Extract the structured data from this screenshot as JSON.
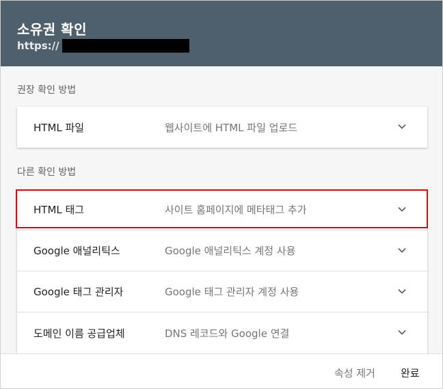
{
  "header": {
    "title": "소유권 확인",
    "url_prefix": "https://"
  },
  "recommended": {
    "label": "권장 확인 방법",
    "items": [
      {
        "name": "HTML 파일",
        "description": "웹사이트에 HTML 파일 업로드",
        "icon": "chevron-down-icon"
      }
    ]
  },
  "other": {
    "label": "다른 확인 방법",
    "items": [
      {
        "name": "HTML 태그",
        "description": "사이트 홈페이지에 메타태그 추가",
        "icon": "chevron-down-icon"
      },
      {
        "name": "Google 애널리틱스",
        "description": "Google 애널리틱스 계정 사용",
        "icon": "chevron-down-icon"
      },
      {
        "name": "Google 태그 관리자",
        "description": "Google 태그 관리자 계정 사용",
        "icon": "chevron-down-icon"
      },
      {
        "name": "도메인 이름 공급업체",
        "description": "DNS 레코드와 Google 연결",
        "icon": "chevron-down-icon"
      }
    ]
  },
  "footer": {
    "remove_label": "속성 제거",
    "done_label": "완료"
  },
  "colors": {
    "header_bg": "#4f606c",
    "highlight": "#d9050f"
  }
}
